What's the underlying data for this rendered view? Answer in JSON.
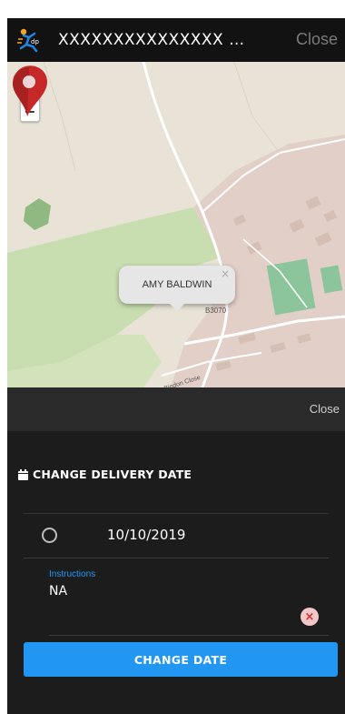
{
  "header": {
    "title": "XXXXXXXXXXXXXXX …",
    "close_label": "Close",
    "logo_icon": "runner-logo-icon"
  },
  "map": {
    "zoom_in_label": "+",
    "zoom_out_label": "−",
    "popup_name": "AMY BALDWIN",
    "popup_close": "×",
    "road_label": "B3070",
    "street_label": "Bindon Close",
    "marker_icon": "location-pin-icon"
  },
  "sheet": {
    "close_label": "Close",
    "section_title": "CHANGE DELIVERY DATE",
    "section_icon": "calendar-icon",
    "date_value": "10/10/2019",
    "instructions_label": "Instructions",
    "instructions_value": "NA",
    "change_button_label": "CHANGE DATE"
  },
  "colors": {
    "accent": "#2196f3",
    "header_bg": "#121212",
    "sheet_bg": "#1c1c1c",
    "marker": "#c62828",
    "clear_icon": "#d32f2f"
  }
}
